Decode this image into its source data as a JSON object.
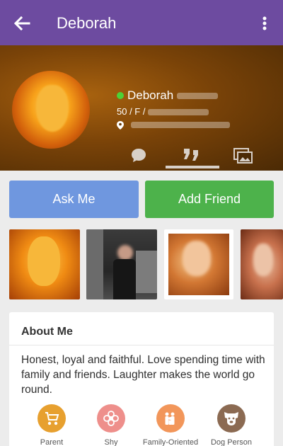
{
  "appbar": {
    "title": "Deborah"
  },
  "profile": {
    "name": "Deborah",
    "age_gender": "50 / F /"
  },
  "actions": {
    "ask_label": "Ask Me",
    "add_label": "Add Friend"
  },
  "about": {
    "title": "About Me",
    "bio": "Honest, loyal and faithful. Love spending time with family and friends. Laughter makes the world go round.",
    "traits": [
      {
        "label": "Parent",
        "color": "#e7a02f",
        "icon": "stroller-icon"
      },
      {
        "label": "Shy",
        "color": "#ee8f8b",
        "icon": "flower-icon"
      },
      {
        "label": "Family-Oriented",
        "color": "#f2965a",
        "icon": "family-icon"
      },
      {
        "label": "Dog Person",
        "color": "#8b6a52",
        "icon": "dog-icon"
      }
    ]
  },
  "colors": {
    "appbar": "#6d4ba0",
    "ask": "#6f97df",
    "add": "#4db24b",
    "online": "#4cd137"
  }
}
